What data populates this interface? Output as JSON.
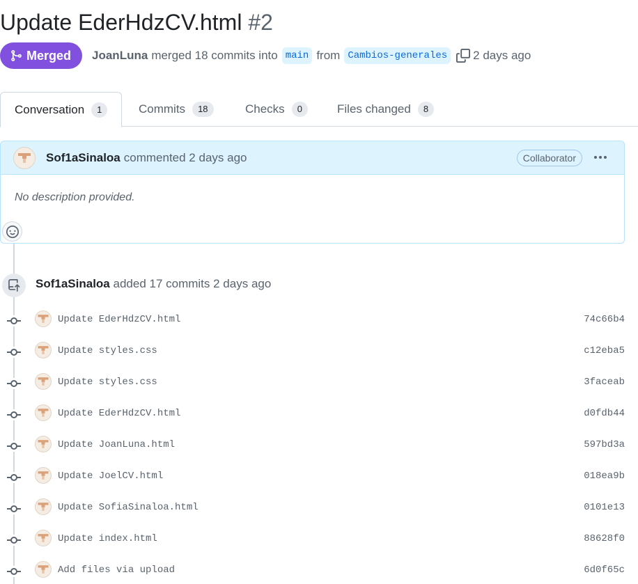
{
  "pr": {
    "title": "Update EderHdzCV.html",
    "number": "#2",
    "state": "Merged",
    "merger": "JoanLuna",
    "merged_text": "merged 18 commits into",
    "base_branch": "main",
    "from_text": "from",
    "head_branch": "Cambios-generales",
    "time": "2 days ago"
  },
  "tabs": [
    {
      "label": "Conversation",
      "count": "1"
    },
    {
      "label": "Commits",
      "count": "18"
    },
    {
      "label": "Checks",
      "count": "0"
    },
    {
      "label": "Files changed",
      "count": "8"
    }
  ],
  "comment": {
    "author": "Sof1aSinaloa",
    "action": "commented 2 days ago",
    "role": "Collaborator",
    "body": "No description provided."
  },
  "push_event": {
    "author": "Sof1aSinaloa",
    "action": "added 17 commits 2 days ago"
  },
  "commits": [
    {
      "message": "Update EderHdzCV.html",
      "sha": "74c66b4"
    },
    {
      "message": "Update styles.css",
      "sha": "c12eba5"
    },
    {
      "message": "Update styles.css",
      "sha": "3faceab"
    },
    {
      "message": "Update EderHdzCV.html",
      "sha": "d0fdb44"
    },
    {
      "message": "Update JoanLuna.html",
      "sha": "597bd3a"
    },
    {
      "message": "Update JoelCV.html",
      "sha": "018ea9b"
    },
    {
      "message": "Update SofiaSinaloa.html",
      "sha": "0101e13"
    },
    {
      "message": "Update index.html",
      "sha": "88628f0"
    },
    {
      "message": "Add files via upload",
      "sha": "6d0f65c"
    }
  ],
  "colors": {
    "merged_purple": "#8250df",
    "link_blue": "#0969da",
    "comment_header_bg": "#ddf4ff"
  }
}
